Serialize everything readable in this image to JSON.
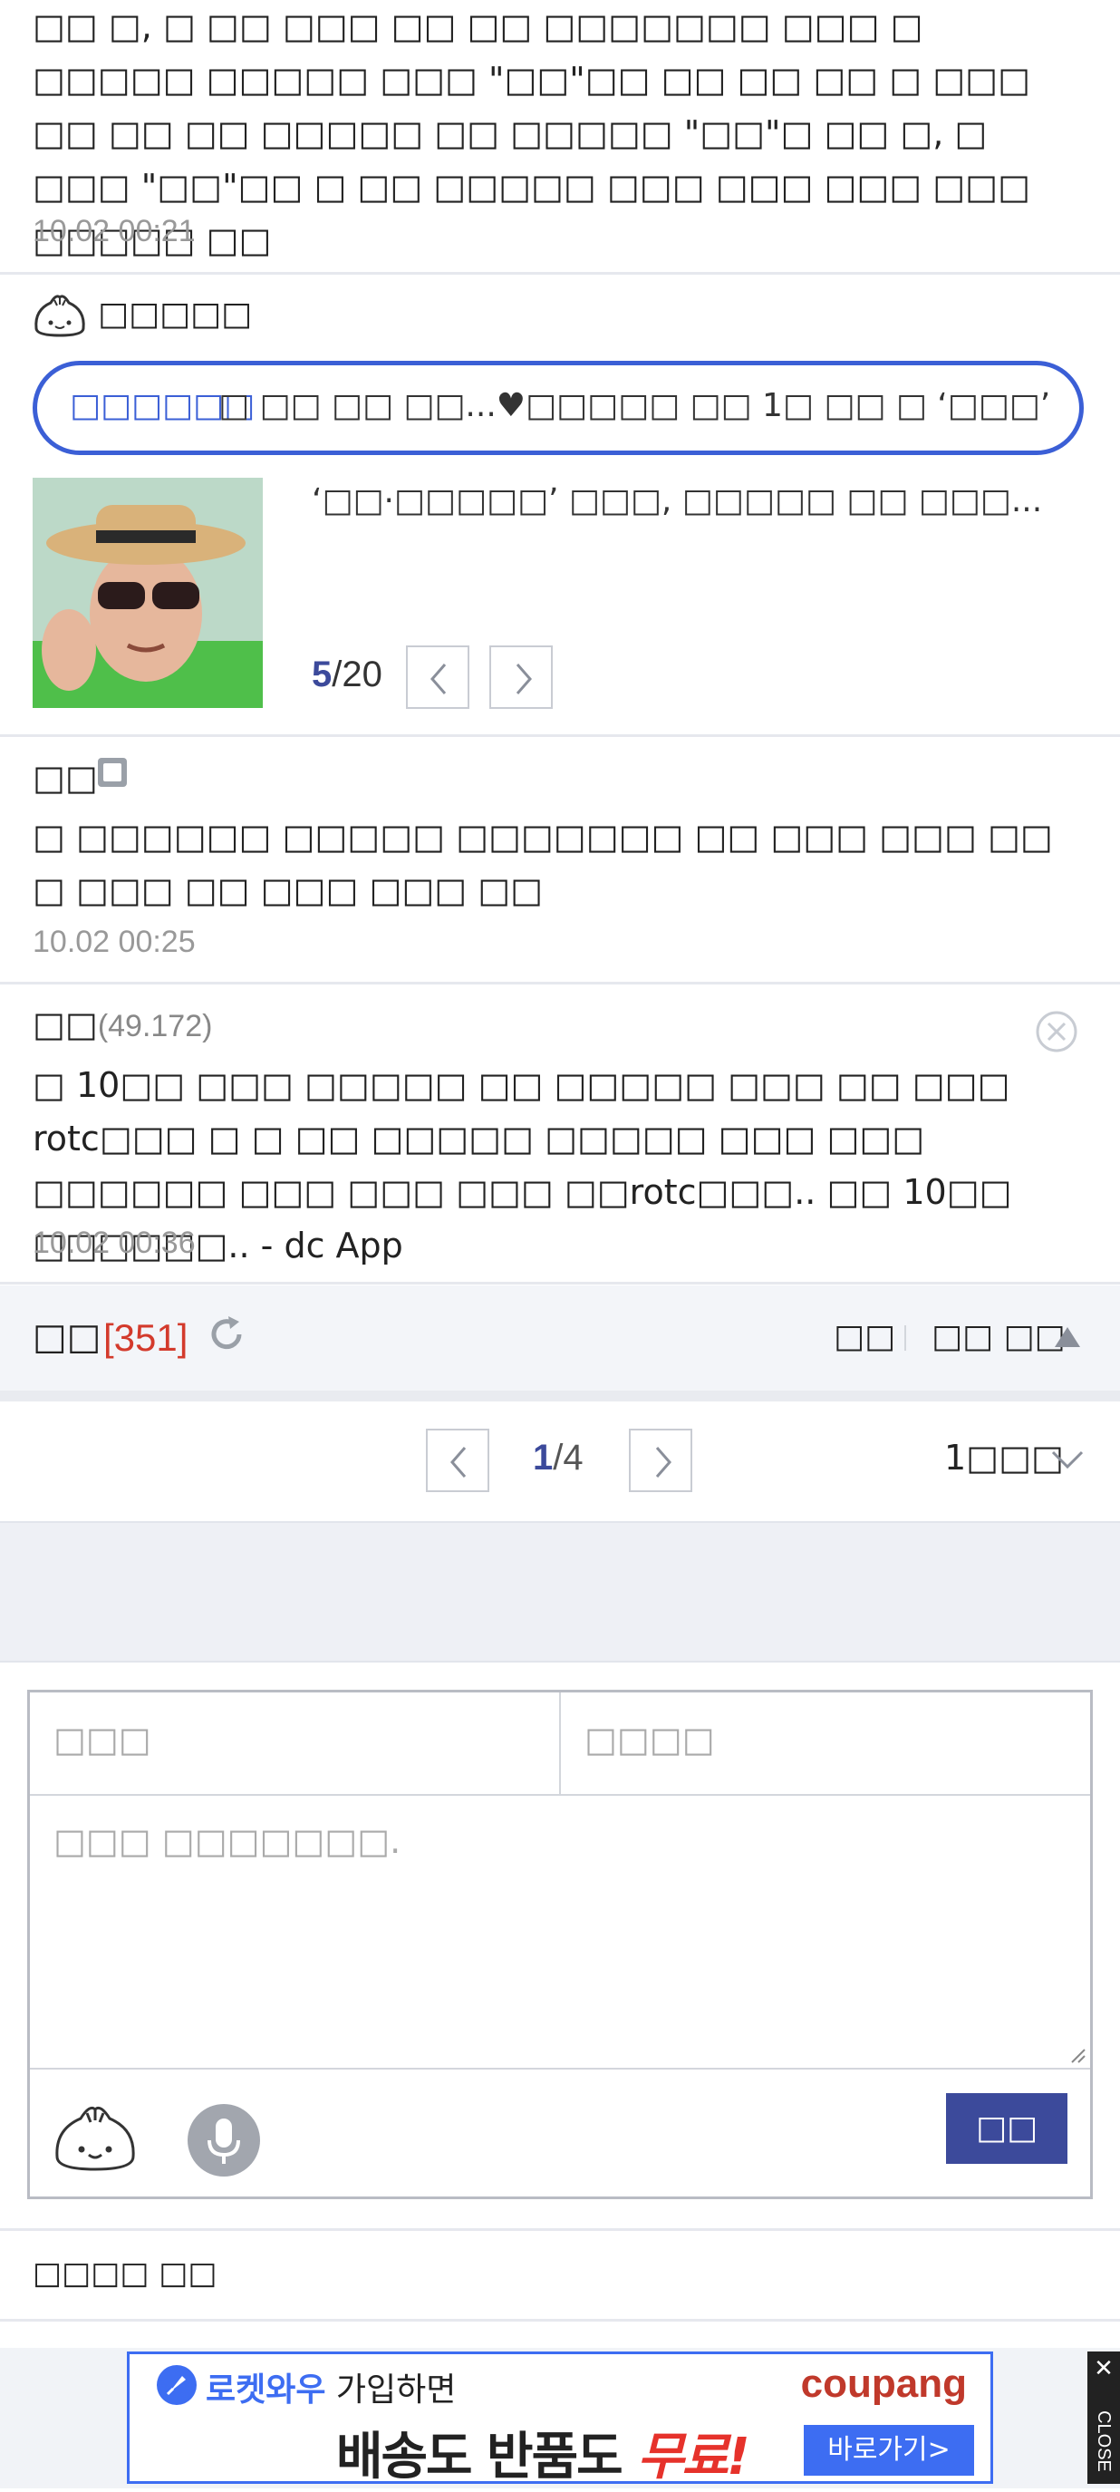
{
  "comments": [
    {
      "id": "c1",
      "text": "□□ □, □ □□ □□□ □□ □□ □□□□□□□ □□□ □ □□□□□ □□□□□ □□□ \"□□\"□□ □□ □□ □□ □ □□□ □□ □□ □□ □□□□□ □□ □□□□□ \"□□\"□ □□ □, □ □□□ \"□□\"□□ □ □□ □□□□□ □□□ □□□ □□□ □□□ □□□□□ □□",
      "date": "10.02 00:21"
    }
  ],
  "dccon": {
    "label": "□□□□□",
    "search_tag": "□□□□□□",
    "search_text": "□ □□ □□ □□...♥□□□□□ □□ 1□ □□ □ ‘□□□’",
    "news_title": "‘□□·□□□□□’ □□□, □□□□□ □□ □□□...",
    "counter_current": "5",
    "counter_total": "/20"
  },
  "comment2": {
    "nick": "□□",
    "text": "□ □□□□□□ □□□□□ □□□□□□□ □□ □□□ □□□ □□ □ □□□ □□ □□□ □□□ □□",
    "date": "10.02 00:25"
  },
  "comment3": {
    "nick": "□□",
    "ip": "(49.172)",
    "text": "□ 10□□ □□□ □□□□□ □□ □□□□□ □□□ □□ □□□ rotc□□□ □ □ □□ □□□□□ □□□□□ □□□ □□□ □□□□□□ □□□ □□□ □□□ □□rotc□□□.. □□ 10□□ □□□□□□.. - dc App",
    "date": "10.02 00:36"
  },
  "reply": {
    "title": "□□",
    "count": "[351]",
    "sort_label": "□□",
    "fold_label": "□□ □□",
    "page_current": "1",
    "page_total": "/4",
    "page_select": "1□□□",
    "name_placeholder": "□□□",
    "password_placeholder": "□□□□",
    "content_placeholder": "□□□ □□□□□□□.",
    "submit_label": "□□",
    "footer_text": "□□□□ □□"
  },
  "ad": {
    "line1_brand": "로켓와우",
    "line1_rest": " 가입하면",
    "coupang": "coupang",
    "line2": "배송도 반품도 ",
    "line2_red": "무료!",
    "cta": "바로가기>",
    "close": "CLOSE",
    "close_x": "✕"
  },
  "colors": {
    "accent": "#3b5fd6",
    "count_red": "#d33a2c",
    "submit": "#3c4a9b",
    "coupang_red": "#e6322b"
  }
}
